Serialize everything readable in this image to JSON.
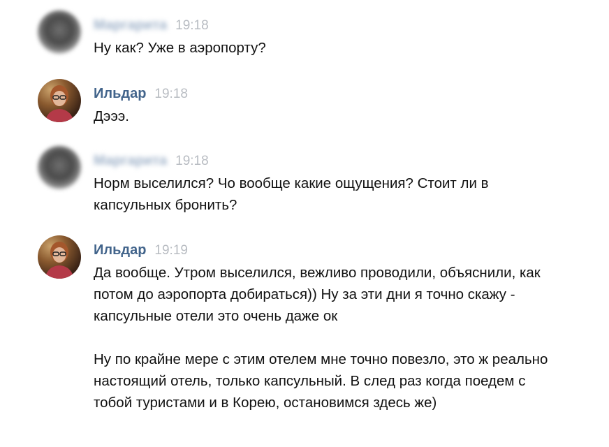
{
  "messages": [
    {
      "author": "Маргарита",
      "author_blurred": true,
      "time": "19:18",
      "paragraphs": [
        "Ну как? Уже в аэропорту?"
      ]
    },
    {
      "author": "Ильдар",
      "author_blurred": false,
      "time": "19:18",
      "paragraphs": [
        "Дэээ."
      ]
    },
    {
      "author": "Маргарита",
      "author_blurred": true,
      "time": "19:18",
      "paragraphs": [
        "Норм выселился? Чо вообще какие ощущения? Стоит ли в капсульных бронить?"
      ]
    },
    {
      "author": "Ильдар",
      "author_blurred": false,
      "time": "19:19",
      "paragraphs": [
        "Да вообще. Утром выселился, вежливо проводили, объяснили, как потом до аэропорта добираться)) Ну за эти дни я точно скажу - капсульные отели это очень даже ок",
        "Ну по крайне мере с этим отелем мне точно повезло, это ж реально настоящий отель, только капсульный. В след раз когда поедем с тобой туристами и в Корею, остановимся здесь же)"
      ]
    }
  ],
  "colors": {
    "author": "#42648b",
    "time": "#b8bcc2",
    "text": "#111111"
  }
}
